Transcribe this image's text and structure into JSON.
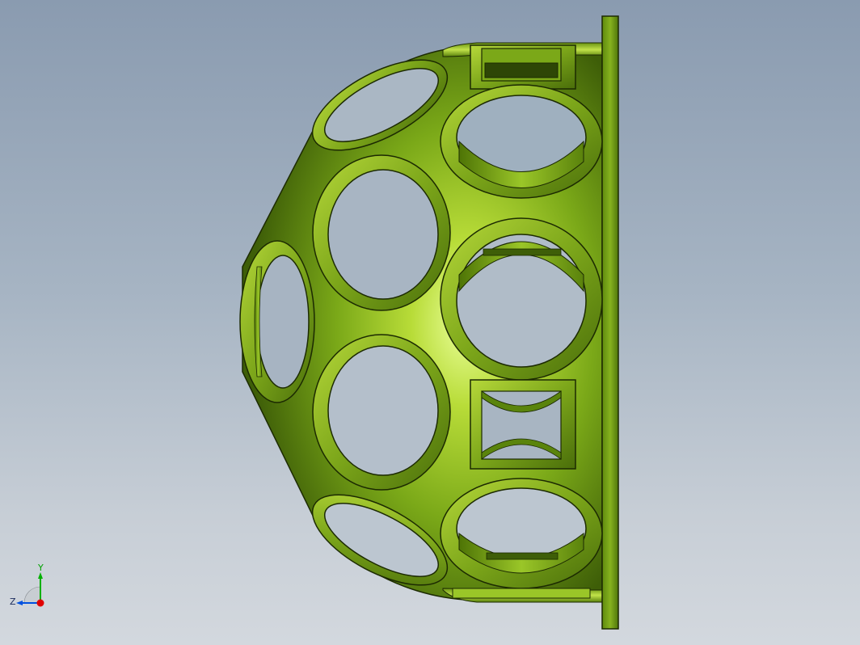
{
  "viewport": {
    "background_top": "#8a9bb0",
    "background_bottom": "#d3d8de"
  },
  "model": {
    "part": "hemispherical-dome-with-round-and-square-openings",
    "color_base": "#6e9a12",
    "color_highlight": "#eaff9a",
    "color_shadow": "#2f4a05",
    "outline_color": "#1c2a02"
  },
  "triad": {
    "x_color": "#e00000",
    "y_color": "#00b000",
    "z_color": "#0050e0",
    "y_label": "Y",
    "z_label": "Z"
  }
}
